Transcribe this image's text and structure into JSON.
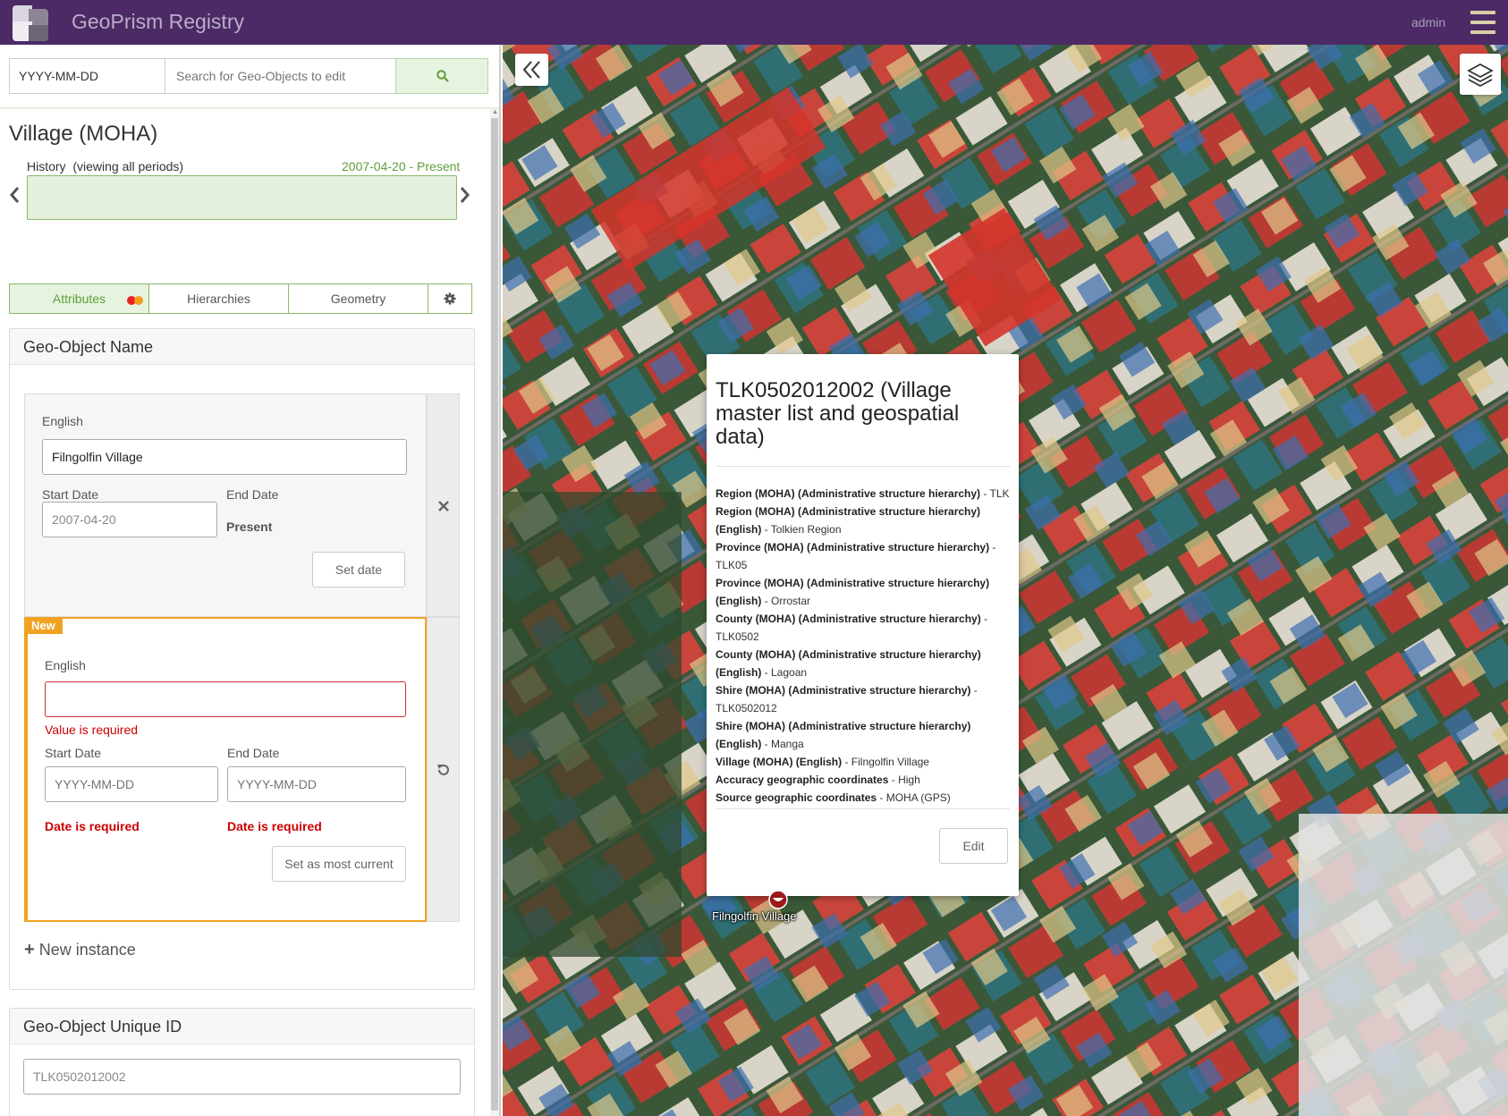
{
  "header": {
    "app_title": "GeoPrism Registry",
    "user": "admin"
  },
  "search": {
    "date_value": "YYYY-MM-DD",
    "placeholder": "Search for Geo-Objects to edit"
  },
  "object": {
    "title": "Village (MOHA)",
    "history_label": "History  (viewing all periods)",
    "history_range": "2007-04-20 - Present"
  },
  "tabs": [
    {
      "label": "Attributes"
    },
    {
      "label": "Hierarchies"
    },
    {
      "label": "Geometry"
    }
  ],
  "status_colors": {
    "dot1": "#e8231f",
    "dot2": "#f59a1b",
    "accent": "#5f9f3a",
    "warning": "#f0a321"
  },
  "name_card": {
    "title": "Geo-Object Name",
    "existing": {
      "locale_label": "English",
      "value": "Filngolfin Village",
      "start_label": "Start Date",
      "end_label": "End Date",
      "start_value": "2007-04-20",
      "end_value": "Present",
      "set_date": "Set date"
    },
    "new": {
      "tag": "New",
      "locale_label": "English",
      "value": "",
      "value_error": "Value is required",
      "start_label": "Start Date",
      "end_label": "End Date",
      "date_placeholder": "YYYY-MM-DD",
      "start_error": "Date is required",
      "end_error": "Date is required",
      "set_current": "Set as most current"
    },
    "new_instance": "New instance"
  },
  "id_card": {
    "title": "Geo-Object Unique ID",
    "value": "TLK0502012002"
  },
  "popup": {
    "title": "TLK0502012002 (Village master list and geospatial data)",
    "rows": [
      {
        "key": "Region (MOHA) (Administrative structure hierarchy)",
        "value": "TLK"
      },
      {
        "key": "Region (MOHA) (Administrative structure hierarchy) (English)",
        "value": "Tolkien Region"
      },
      {
        "key": "Province (MOHA) (Administrative structure hierarchy)",
        "value": "TLK05"
      },
      {
        "key": "Province (MOHA) (Administrative structure hierarchy) (English)",
        "value": "Orrostar"
      },
      {
        "key": "County (MOHA) (Administrative structure hierarchy)",
        "value": "TLK0502"
      },
      {
        "key": "County (MOHA) (Administrative structure hierarchy) (English)",
        "value": "Lagoan"
      },
      {
        "key": "Shire (MOHA) (Administrative structure hierarchy)",
        "value": "TLK0502012"
      },
      {
        "key": "Shire (MOHA) (Administrative structure hierarchy) (English)",
        "value": "Manga"
      },
      {
        "key": "Village (MOHA) (English)",
        "value": "Filngolfin Village"
      },
      {
        "key": "Accuracy geographic coordinates",
        "value": "High"
      },
      {
        "key": "Source geographic coordinates",
        "value": "MOHA (GPS)"
      }
    ],
    "edit": "Edit"
  },
  "marker": {
    "label": "Filngolfin Village"
  }
}
